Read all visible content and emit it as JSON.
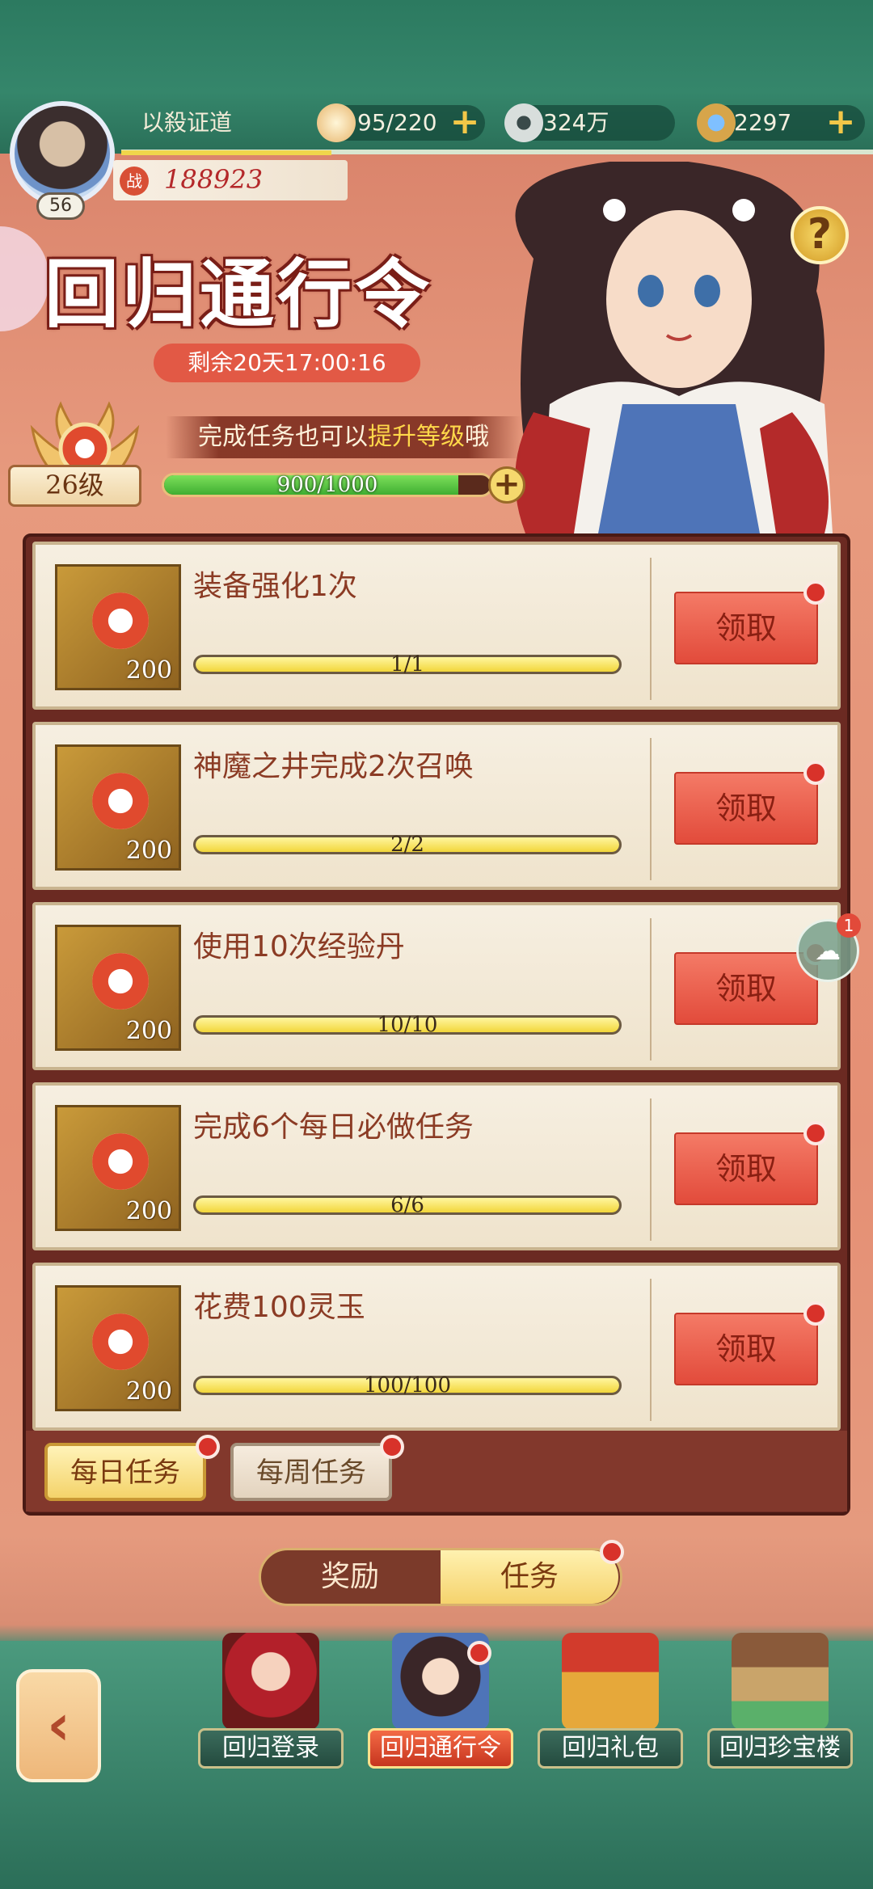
{
  "player": {
    "name": "以殺证道",
    "level": "56",
    "power_icon": "战",
    "power": "188923"
  },
  "resources": [
    {
      "icon": "bun-icon",
      "value": "95/220"
    },
    {
      "icon": "coin-icon",
      "value": "324万"
    },
    {
      "icon": "jade-icon",
      "value": "2297"
    }
  ],
  "banner": {
    "title": "回归通行令",
    "timer": "剩余20天17:00:16",
    "tip_prefix": "完成任务也可以",
    "tip_highlight": "提升等级",
    "tip_suffix": "哦",
    "help_label": "?"
  },
  "pass": {
    "level": "26级",
    "progress_text": "900/1000",
    "progress_fraction": 0.9
  },
  "tasks": [
    {
      "title": "装备强化1次",
      "reward": "200",
      "progress": "1/1",
      "fraction": 1.0,
      "button": "领取"
    },
    {
      "title": "神魔之井完成2次召唤",
      "reward": "200",
      "progress": "2/2",
      "fraction": 1.0,
      "button": "领取"
    },
    {
      "title": "使用10次经验丹",
      "reward": "200",
      "progress": "10/10",
      "fraction": 1.0,
      "button": "领取"
    },
    {
      "title": "完成6个每日必做任务",
      "reward": "200",
      "progress": "6/6",
      "fraction": 1.0,
      "button": "领取"
    },
    {
      "title": "花费100灵玉",
      "reward": "200",
      "progress": "100/100",
      "fraction": 1.0,
      "button": "领取"
    }
  ],
  "task_tabs": {
    "daily": "每日任务",
    "weekly": "每周任务"
  },
  "switch": {
    "rewards": "奖励",
    "tasks": "任务"
  },
  "chat": {
    "count": "1"
  },
  "bottom_nav": [
    {
      "label": "回归登录"
    },
    {
      "label": "回归通行令"
    },
    {
      "label": "回归礼包"
    },
    {
      "label": "回归珍宝楼"
    }
  ],
  "colors": {
    "accent_red": "#e24b3b",
    "gold": "#f4d36a",
    "panel": "#6b2a22",
    "teal": "#2f7a63"
  }
}
